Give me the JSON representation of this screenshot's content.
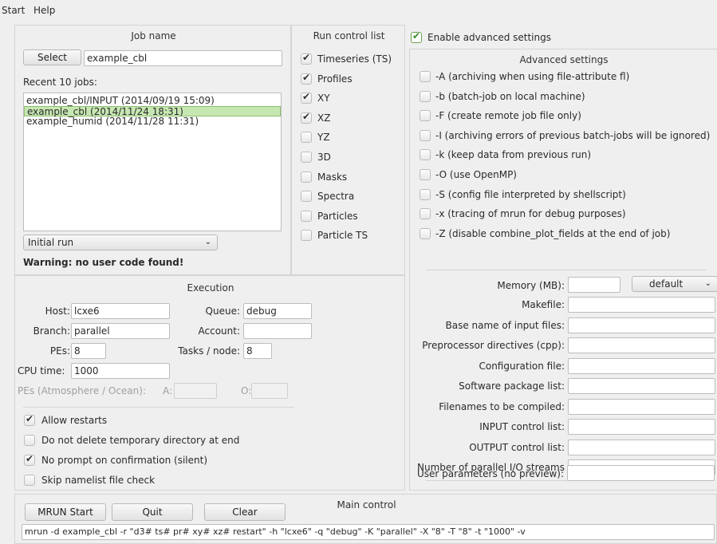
{
  "menu": {
    "items": [
      "Start",
      "Help"
    ]
  },
  "job": {
    "title": "Job name",
    "select_label": "Select",
    "name_value": "example_cbl",
    "recent_label": "Recent 10 jobs:",
    "recent_jobs": [
      "example_cbl/INPUT (2014/09/19 15:09)",
      "example_cbl (2014/11/24 18:31)",
      "example_humid (2014/11/28 11:31)"
    ],
    "selected_index": 1,
    "run_type": "Initial run",
    "warning": "Warning: no user code found!"
  },
  "run_control": {
    "title": "Run control list",
    "items": [
      {
        "label": "Timeseries (TS)",
        "checked": true
      },
      {
        "label": "Profiles",
        "checked": true
      },
      {
        "label": "XY",
        "checked": true
      },
      {
        "label": "XZ",
        "checked": true
      },
      {
        "label": "YZ",
        "checked": false
      },
      {
        "label": "3D",
        "checked": false
      },
      {
        "label": "Masks",
        "checked": false
      },
      {
        "label": "Spectra",
        "checked": false
      },
      {
        "label": "Particles",
        "checked": false
      },
      {
        "label": "Particle TS",
        "checked": false
      }
    ]
  },
  "execution": {
    "title": "Execution",
    "host_label": "Host:",
    "host_value": "lcxe6",
    "queue_label": "Queue:",
    "queue_value": "debug",
    "branch_label": "Branch:",
    "branch_value": "parallel",
    "account_label": "Account:",
    "account_value": "",
    "pes_label": "PEs:",
    "pes_value": "8",
    "tasks_label": "Tasks / node:",
    "tasks_value": "8",
    "cpu_label": "CPU time:",
    "cpu_value": "1000",
    "pes_ao_label": "PEs (Atmosphere / Ocean):",
    "a_label": "A:",
    "o_label": "O:",
    "options": [
      {
        "label": "Allow restarts",
        "checked": true
      },
      {
        "label": "Do not delete temporary directory at end",
        "checked": false
      },
      {
        "label": "No prompt on confirmation (silent)",
        "checked": true
      },
      {
        "label": "Skip namelist file check",
        "checked": false
      }
    ]
  },
  "advanced": {
    "enable_label": "Enable advanced settings",
    "enable_checked": true,
    "title": "Advanced settings",
    "flags": [
      "-A  (archiving when using file-attribute fl)",
      "-b  (batch-job on local machine)",
      "-F  (create remote job file only)",
      "-I  (archiving errors of previous batch-jobs will be ignored)",
      "-k  (keep data from previous run)",
      "-O  (use OpenMP)",
      "-S  (config file interpreted by shellscript)",
      "-x  (tracing of mrun for debug purposes)",
      "-Z  (disable combine_plot_fields at the end of job)"
    ],
    "memory_label": "Memory (MB):",
    "memory_value": "",
    "memory_option": "default",
    "fields": [
      "Makefile:",
      "Base name of input files:",
      "Preprocessor directives (cpp):",
      "Configuration file:",
      "Software package list:",
      "Filenames to be compiled:",
      "INPUT control list:",
      "OUTPUT control list:",
      "Number of parallel I/O streams"
    ],
    "user_params_label": "User parameters (no preview):"
  },
  "main_control": {
    "title": "Main control",
    "start_label": "MRUN Start",
    "quit_label": "Quit",
    "clear_label": "Clear",
    "command": "mrun -d example_cbl -r \"d3# ts# pr# xy# xz# restart\" -h \"lcxe6\" -q \"debug\" -K \"parallel\" -X \"8\" -T \"8\" -t \"1000\" -v"
  }
}
